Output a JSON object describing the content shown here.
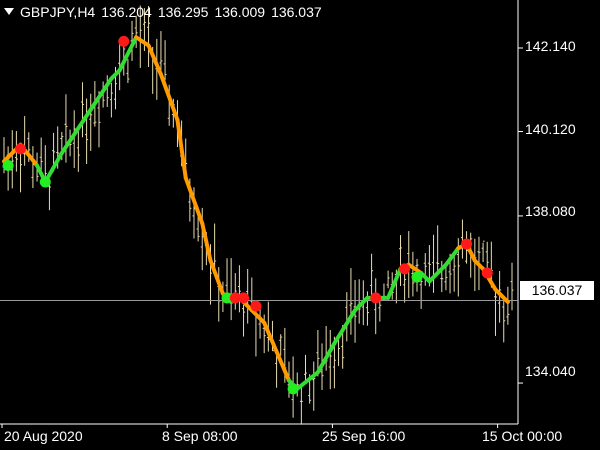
{
  "header": {
    "symbol": "GBPJPY,H4",
    "open": "136.204",
    "high": "136.295",
    "low": "136.009",
    "close": "136.037"
  },
  "colors": {
    "background": "#000000",
    "candles": "#e8dcb0",
    "uptrend": "#33dd33",
    "downtrend": "#ff9a00",
    "signal_sell": "#ff1a1a",
    "signal_buy": "#22ee22",
    "axis": "#ffffff",
    "price_line": "#9a9a9a"
  },
  "current_price_label": "136.037",
  "chart_data": {
    "type": "line",
    "title": "GBPJPY,H4",
    "y_ticks": [
      "142.140",
      "140.120",
      "138.080",
      "134.040"
    ],
    "x_ticks": [
      "20 Aug 2020",
      "8 Sep 08:00",
      "25 Sep 16:00",
      "15 Oct 00:00"
    ],
    "ylim": [
      133.05,
      143.3
    ],
    "current_price": 136.037,
    "bar_count": 124,
    "indicator": [
      [
        0,
        139.4,
        "down"
      ],
      [
        4,
        139.8,
        "down"
      ],
      [
        8,
        139.3,
        "down"
      ],
      [
        10,
        138.9,
        "up"
      ],
      [
        14,
        139.6,
        "up"
      ],
      [
        18,
        140.2,
        "up"
      ],
      [
        22,
        140.8,
        "up"
      ],
      [
        26,
        141.4,
        "up"
      ],
      [
        28,
        141.6,
        "up"
      ],
      [
        32,
        142.4,
        "up"
      ],
      [
        35,
        142.2,
        "down"
      ],
      [
        38,
        141.5,
        "down"
      ],
      [
        42,
        140.4,
        "down"
      ],
      [
        44,
        139.0,
        "down"
      ],
      [
        48,
        137.9,
        "down"
      ],
      [
        50,
        137.0,
        "down"
      ],
      [
        53,
        136.2,
        "down"
      ],
      [
        55,
        136.0,
        "down"
      ],
      [
        57,
        136.1,
        "up"
      ],
      [
        58,
        136.0,
        "down"
      ],
      [
        60,
        135.8,
        "down"
      ],
      [
        63,
        135.5,
        "down"
      ],
      [
        66,
        134.8,
        "down"
      ],
      [
        69,
        134.1,
        "down"
      ],
      [
        71,
        133.9,
        "up"
      ],
      [
        76,
        134.3,
        "up"
      ],
      [
        80,
        135.0,
        "up"
      ],
      [
        85,
        135.8,
        "up"
      ],
      [
        88,
        136.1,
        "up"
      ],
      [
        93,
        136.1,
        "up"
      ],
      [
        96,
        136.8,
        "up"
      ],
      [
        98,
        136.9,
        "down"
      ],
      [
        101,
        136.7,
        "down"
      ],
      [
        103,
        136.5,
        "up"
      ],
      [
        107,
        136.9,
        "up"
      ],
      [
        110,
        137.3,
        "up"
      ],
      [
        112,
        137.4,
        "down"
      ],
      [
        114,
        137.0,
        "down"
      ],
      [
        116,
        136.8,
        "down"
      ],
      [
        119,
        136.3,
        "down"
      ],
      [
        122,
        136.0,
        "down"
      ]
    ],
    "signals": [
      {
        "x": 1,
        "y": 139.3,
        "type": "buy"
      },
      {
        "x": 4,
        "y": 139.7,
        "type": "sell"
      },
      {
        "x": 10,
        "y": 138.9,
        "type": "buy"
      },
      {
        "x": 29,
        "y": 142.3,
        "type": "sell"
      },
      {
        "x": 54,
        "y": 136.1,
        "type": "buy"
      },
      {
        "x": 56,
        "y": 136.1,
        "type": "sell"
      },
      {
        "x": 58,
        "y": 136.1,
        "type": "sell"
      },
      {
        "x": 61,
        "y": 135.9,
        "type": "sell"
      },
      {
        "x": 70,
        "y": 133.9,
        "type": "buy"
      },
      {
        "x": 90,
        "y": 136.1,
        "type": "sell"
      },
      {
        "x": 97,
        "y": 136.8,
        "type": "sell"
      },
      {
        "x": 100,
        "y": 136.6,
        "type": "buy"
      },
      {
        "x": 112,
        "y": 137.4,
        "type": "sell"
      },
      {
        "x": 117,
        "y": 136.7,
        "type": "sell"
      }
    ]
  }
}
